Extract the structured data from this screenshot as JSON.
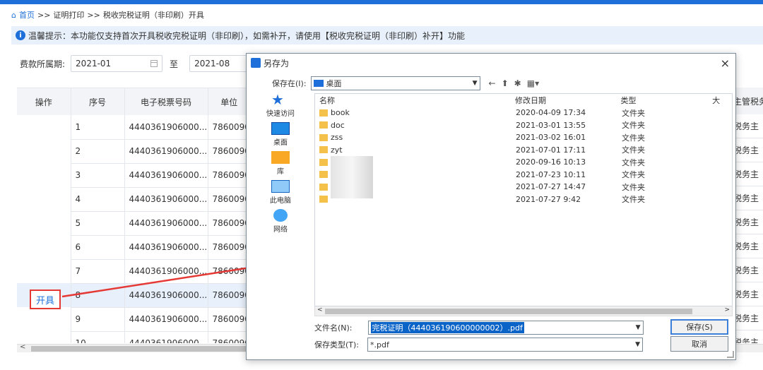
{
  "breadcrumb": {
    "home": "首页",
    "sep1": ">>",
    "item1": "证明打印",
    "sep2": ">>",
    "item2": "税收完税证明（非印刷）开具"
  },
  "tip": {
    "text": "温馨提示：本功能仅支持首次开具税收完税证明（非印刷），如需补开，请使用【税收完税证明（非印刷）补开】功能"
  },
  "filter": {
    "label": "费款所属期:",
    "start": "2021-01",
    "to": "至",
    "end": "2021-08"
  },
  "table": {
    "headers": [
      "操作",
      "序号",
      "电子税票号码",
      "单位"
    ],
    "right_header": "主管税务",
    "rows": [
      {
        "seq": "1",
        "ticket": "4440361906000...",
        "unit": "7860090",
        "right": "税务主"
      },
      {
        "seq": "2",
        "ticket": "4440361906000...",
        "unit": "7860090",
        "right": "税务主"
      },
      {
        "seq": "3",
        "ticket": "4440361906000...",
        "unit": "7860090",
        "right": "税务主"
      },
      {
        "seq": "4",
        "ticket": "4440361906000...",
        "unit": "7860090",
        "right": "税务主"
      },
      {
        "seq": "5",
        "ticket": "4440361906000...",
        "unit": "7860090",
        "right": "税务主"
      },
      {
        "seq": "6",
        "ticket": "4440361906000...",
        "unit": "7860090",
        "right": "税务主"
      },
      {
        "seq": "7",
        "ticket": "4440361906000...",
        "unit": "7860090",
        "right": "税务主"
      },
      {
        "seq": "8",
        "ticket": "4440361906000...",
        "unit": "7860090",
        "right": "税务主"
      },
      {
        "seq": "9",
        "ticket": "4440361906000...",
        "unit": "7860090",
        "right": "税务主"
      },
      {
        "seq": "10",
        "ticket": "4440361906000...",
        "unit": "7860090",
        "right": "税务主"
      }
    ],
    "action_label": "开具"
  },
  "dialog": {
    "title": "另存为",
    "close": "×",
    "save_in_label": "保存在(I):",
    "save_in_value": "桌面",
    "places": [
      "快速访问",
      "桌面",
      "库",
      "此电脑",
      "网络"
    ],
    "columns": {
      "name": "名称",
      "date": "修改日期",
      "type": "类型",
      "size": "大"
    },
    "files": [
      {
        "name": "book",
        "date": "2020-04-09 17:34",
        "type": "文件夹"
      },
      {
        "name": "doc",
        "date": "2021-03-01 13:55",
        "type": "文件夹"
      },
      {
        "name": "zss",
        "date": "2021-03-02 16:01",
        "type": "文件夹"
      },
      {
        "name": "zyt",
        "date": "2021-07-01 17:11",
        "type": "文件夹"
      },
      {
        "name": "",
        "date": "2020-09-16 10:13",
        "type": "文件夹"
      },
      {
        "name": "",
        "date": "2021-07-23 10:11",
        "type": "文件夹"
      },
      {
        "name": "",
        "date": "2021-07-27 14:47",
        "type": "文件夹"
      },
      {
        "name": "",
        "date": "2021-07-27 9:42",
        "type": "文件夹"
      }
    ],
    "filename_label": "文件名(N):",
    "filename_value": "完税证明（444036190600000002）.pdf",
    "filetype_label": "保存类型(T):",
    "filetype_value": "*.pdf",
    "save_button": "保存(S)",
    "cancel_button": "取消"
  },
  "colors": {
    "accent": "#1e6fd9",
    "highlight": "#e53935"
  }
}
